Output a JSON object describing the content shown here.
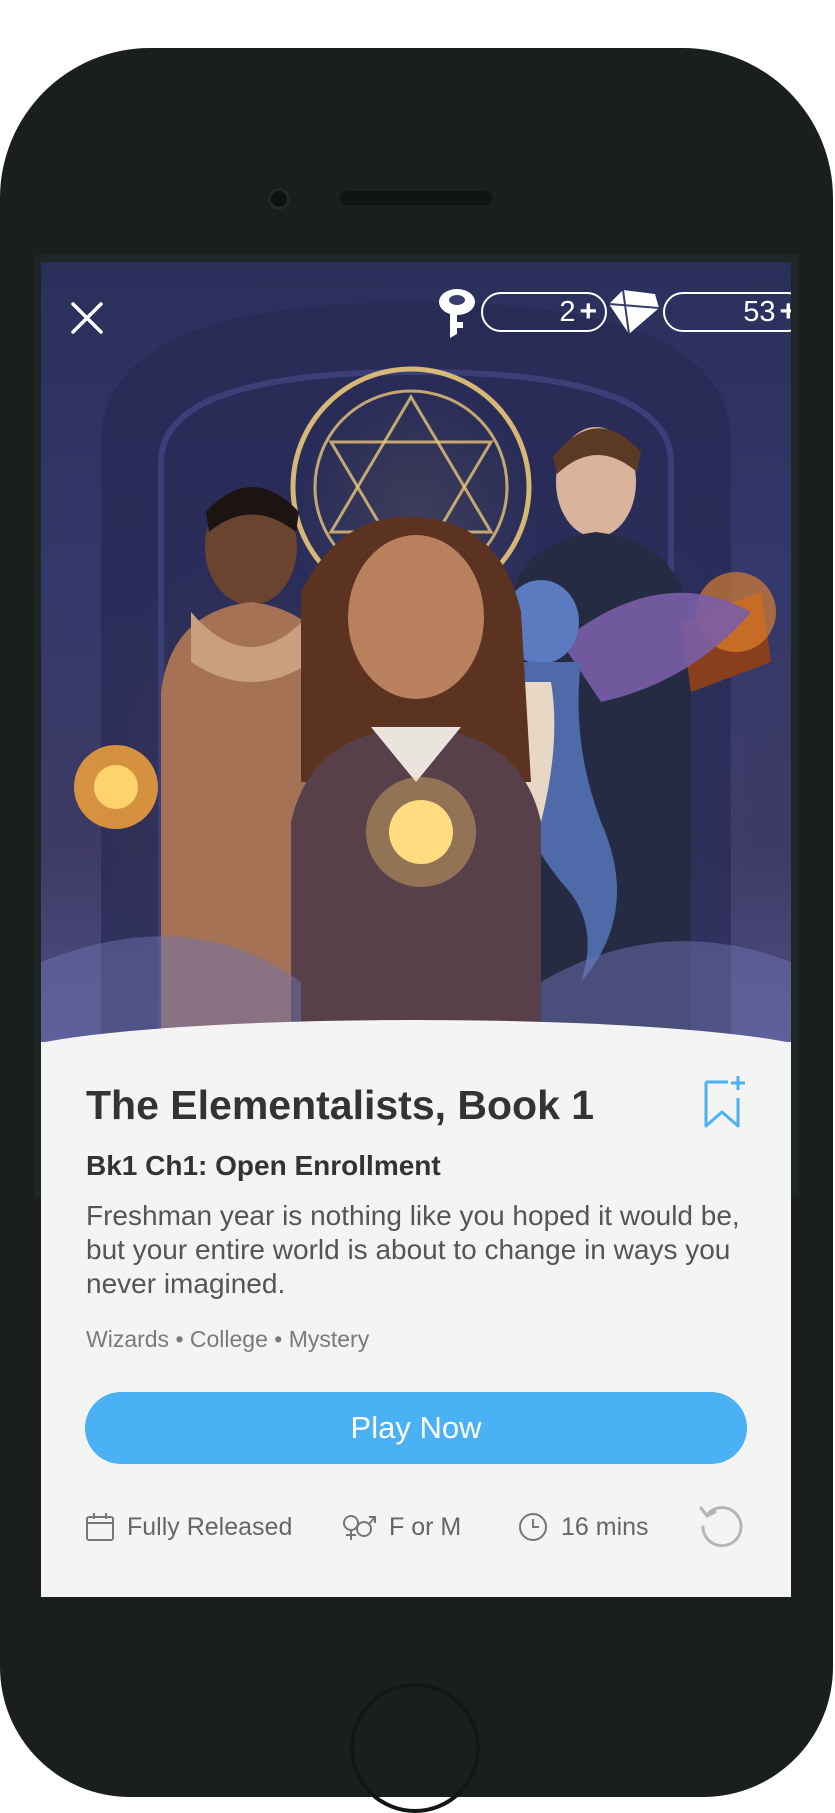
{
  "header": {
    "keys_count": "2",
    "gems_count": "53",
    "plus_symbol": "+"
  },
  "story": {
    "title": "The Elementalists, Book 1",
    "chapter": "Bk1 Ch1: Open Enrollment",
    "description": "Freshman year is nothing like you hoped it would be, but your entire world is about to change in ways you never imagined.",
    "genres": "Wizards • College • Mystery"
  },
  "actions": {
    "play_label": "Play Now"
  },
  "meta": {
    "release_status": "Fully Released",
    "gender": "F or M",
    "duration": "16 mins"
  },
  "colors": {
    "accent": "#4ab1f4",
    "text_dark": "#333333",
    "text_muted": "#7a7a7a",
    "device_frame": "#1a1e1d"
  },
  "icons": [
    "close-icon",
    "key-icon",
    "gem-icon",
    "bookmark-add-icon",
    "calendar-icon",
    "gender-icon",
    "clock-icon",
    "replay-icon"
  ]
}
